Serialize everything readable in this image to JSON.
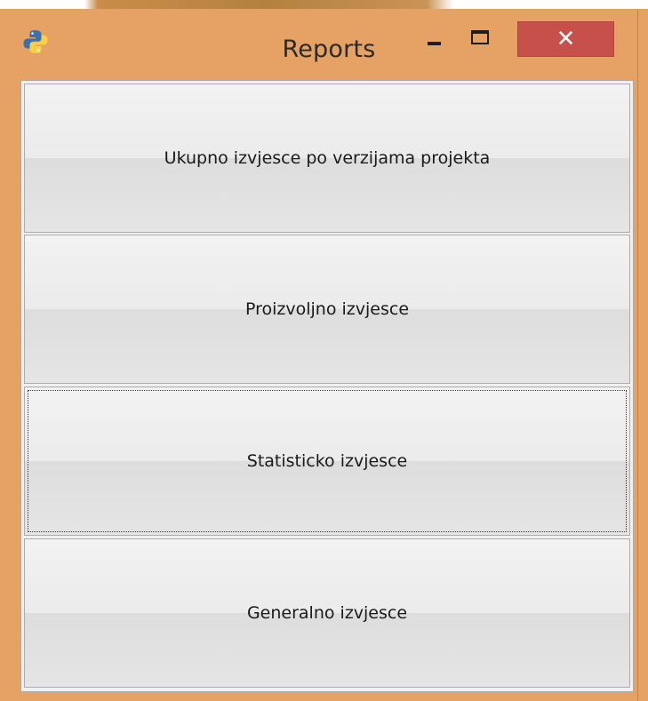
{
  "window": {
    "title": "Reports",
    "controls": {
      "minimize": "minimize-icon",
      "maximize": "maximize-icon",
      "close": "close-icon",
      "close_glyph": "✕",
      "close_color": "#c7504a"
    },
    "app_icon": "python-icon",
    "frame_color": "#e6a165"
  },
  "buttons": [
    {
      "label": "Ukupno izvjesce po verzijama projekta",
      "focused": false
    },
    {
      "label": "Proizvoljno izvjesce",
      "focused": false
    },
    {
      "label": "Statisticko izvjesce",
      "focused": true
    },
    {
      "label": "Generalno izvjesce",
      "focused": false
    }
  ]
}
